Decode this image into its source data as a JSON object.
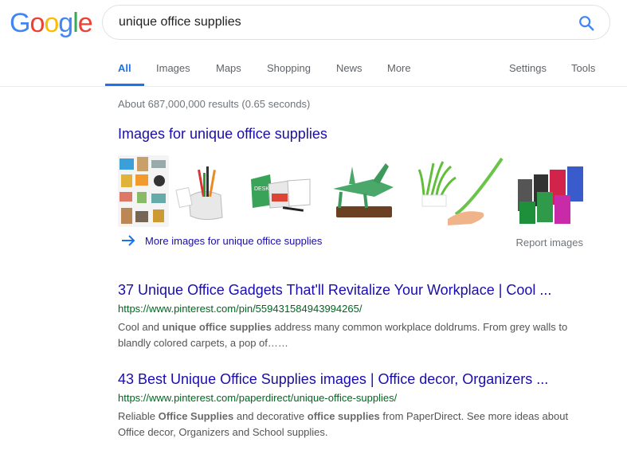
{
  "logo": {
    "letters": [
      "G",
      "o",
      "o",
      "g",
      "l",
      "e"
    ]
  },
  "search": {
    "query": "unique office supplies",
    "icon": "search-icon",
    "icon_color": "#4285F4"
  },
  "tabs": [
    {
      "label": "All",
      "active": true
    },
    {
      "label": "Images"
    },
    {
      "label": "Maps"
    },
    {
      "label": "Shopping"
    },
    {
      "label": "News"
    },
    {
      "label": "More"
    },
    {
      "label": "Settings"
    },
    {
      "label": "Tools"
    }
  ],
  "stats": "About 687,000,000 results (0.65 seconds)",
  "images": {
    "heading": "Images for unique office supplies",
    "more_link": "More images for unique office supplies",
    "report": "Report images",
    "thumbs": [
      "office-supplies-collage",
      "hand-pen-holder",
      "desk-mate-flip-calendar",
      "grasshopper-stapler",
      "grass-pen-holder",
      "trash-bin-organizers"
    ]
  },
  "results": [
    {
      "title": "37 Unique Office Gadgets That'll Revitalize Your Workplace | Cool ...",
      "url": "https://www.pinterest.com/pin/559431584943994265/",
      "snippet_parts": [
        "Cool and ",
        "unique office supplies",
        " address many common workplace doldrums. From grey walls to blandly colored carpets, a pop of……"
      ]
    },
    {
      "title": "43 Best Unique Office Supplies images | Office decor, Organizers ...",
      "url": "https://www.pinterest.com/paperdirect/unique-office-supplies/",
      "snippet_parts": [
        "Reliable ",
        "Office Supplies",
        " and decorative ",
        "office supplies",
        " from PaperDirect. See more ideas about Office decor, Organizers and School supplies."
      ]
    }
  ]
}
